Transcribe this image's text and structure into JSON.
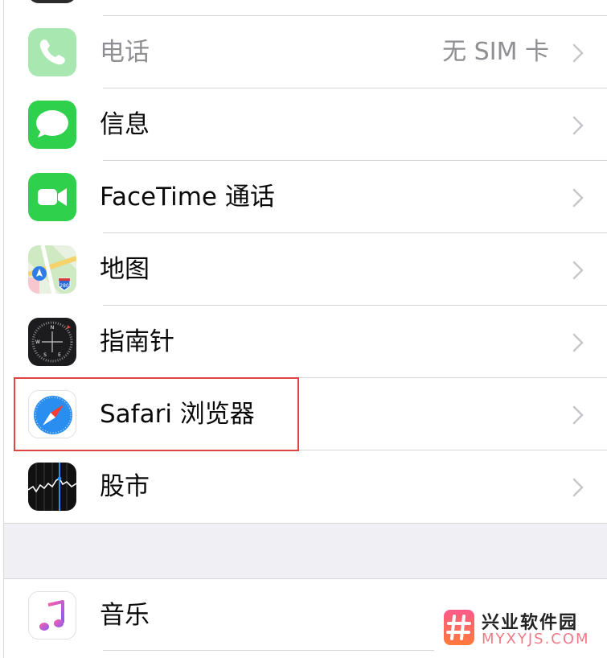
{
  "settings_list": {
    "phone": {
      "label": "电话",
      "value": "无 SIM 卡",
      "icon": "phone-icon"
    },
    "messages": {
      "label": "信息",
      "icon": "messages-icon"
    },
    "facetime": {
      "label": "FaceTime 通话",
      "icon": "facetime-icon"
    },
    "maps": {
      "label": "地图",
      "icon": "maps-icon",
      "icon_text": "280"
    },
    "compass": {
      "label": "指南针",
      "icon": "compass-icon",
      "icon_text": [
        "N",
        "W",
        "S",
        "E"
      ]
    },
    "safari": {
      "label": "Safari 浏览器",
      "icon": "safari-icon",
      "highlighted": true
    },
    "stocks": {
      "label": "股市",
      "icon": "stocks-icon"
    },
    "music": {
      "label": "音乐",
      "icon": "music-icon"
    }
  },
  "watermark": {
    "title": "兴业软件园",
    "subtitle": "MYXYJS.COM"
  },
  "colors": {
    "highlight": "#e0443e",
    "group_gap": "#efeff4",
    "secondary_text": "#8e8e93"
  }
}
